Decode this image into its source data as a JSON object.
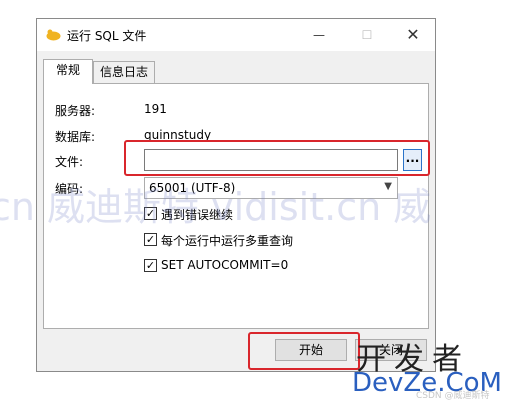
{
  "window": {
    "title": "运行 SQL 文件",
    "min_glyph": "—",
    "max_glyph": "☐",
    "close_glyph": "✕"
  },
  "tabs": [
    {
      "label": "常规"
    },
    {
      "label": "信息日志"
    }
  ],
  "general": {
    "server_label": "服务器:",
    "server_value": "191",
    "database_label": "数据库:",
    "database_value": "quinnstudy",
    "file_label": "文件:",
    "file_value": "",
    "browse_label": "...",
    "encoding_label": "编码:",
    "encoding_value": "65001 (UTF-8)",
    "options": [
      {
        "label": "遇到错误继续",
        "checked": true
      },
      {
        "label": "每个运行中运行多重查询",
        "checked": true
      },
      {
        "label": "SET AUTOCOMMIT=0",
        "checked": true
      }
    ]
  },
  "buttons": {
    "start": "开始",
    "close": "关闭"
  },
  "overlay": {
    "watermark": "cn 威迪斯特 vidisit.cn 威",
    "logo_top": "开发者",
    "logo_bottom": "DevZe.CoM",
    "credit": "CSDN @威迪斯特"
  },
  "colors": {
    "highlight": "#d9262c",
    "logo_blue": "#2a5fbf",
    "browse_border": "#2b74c9"
  }
}
